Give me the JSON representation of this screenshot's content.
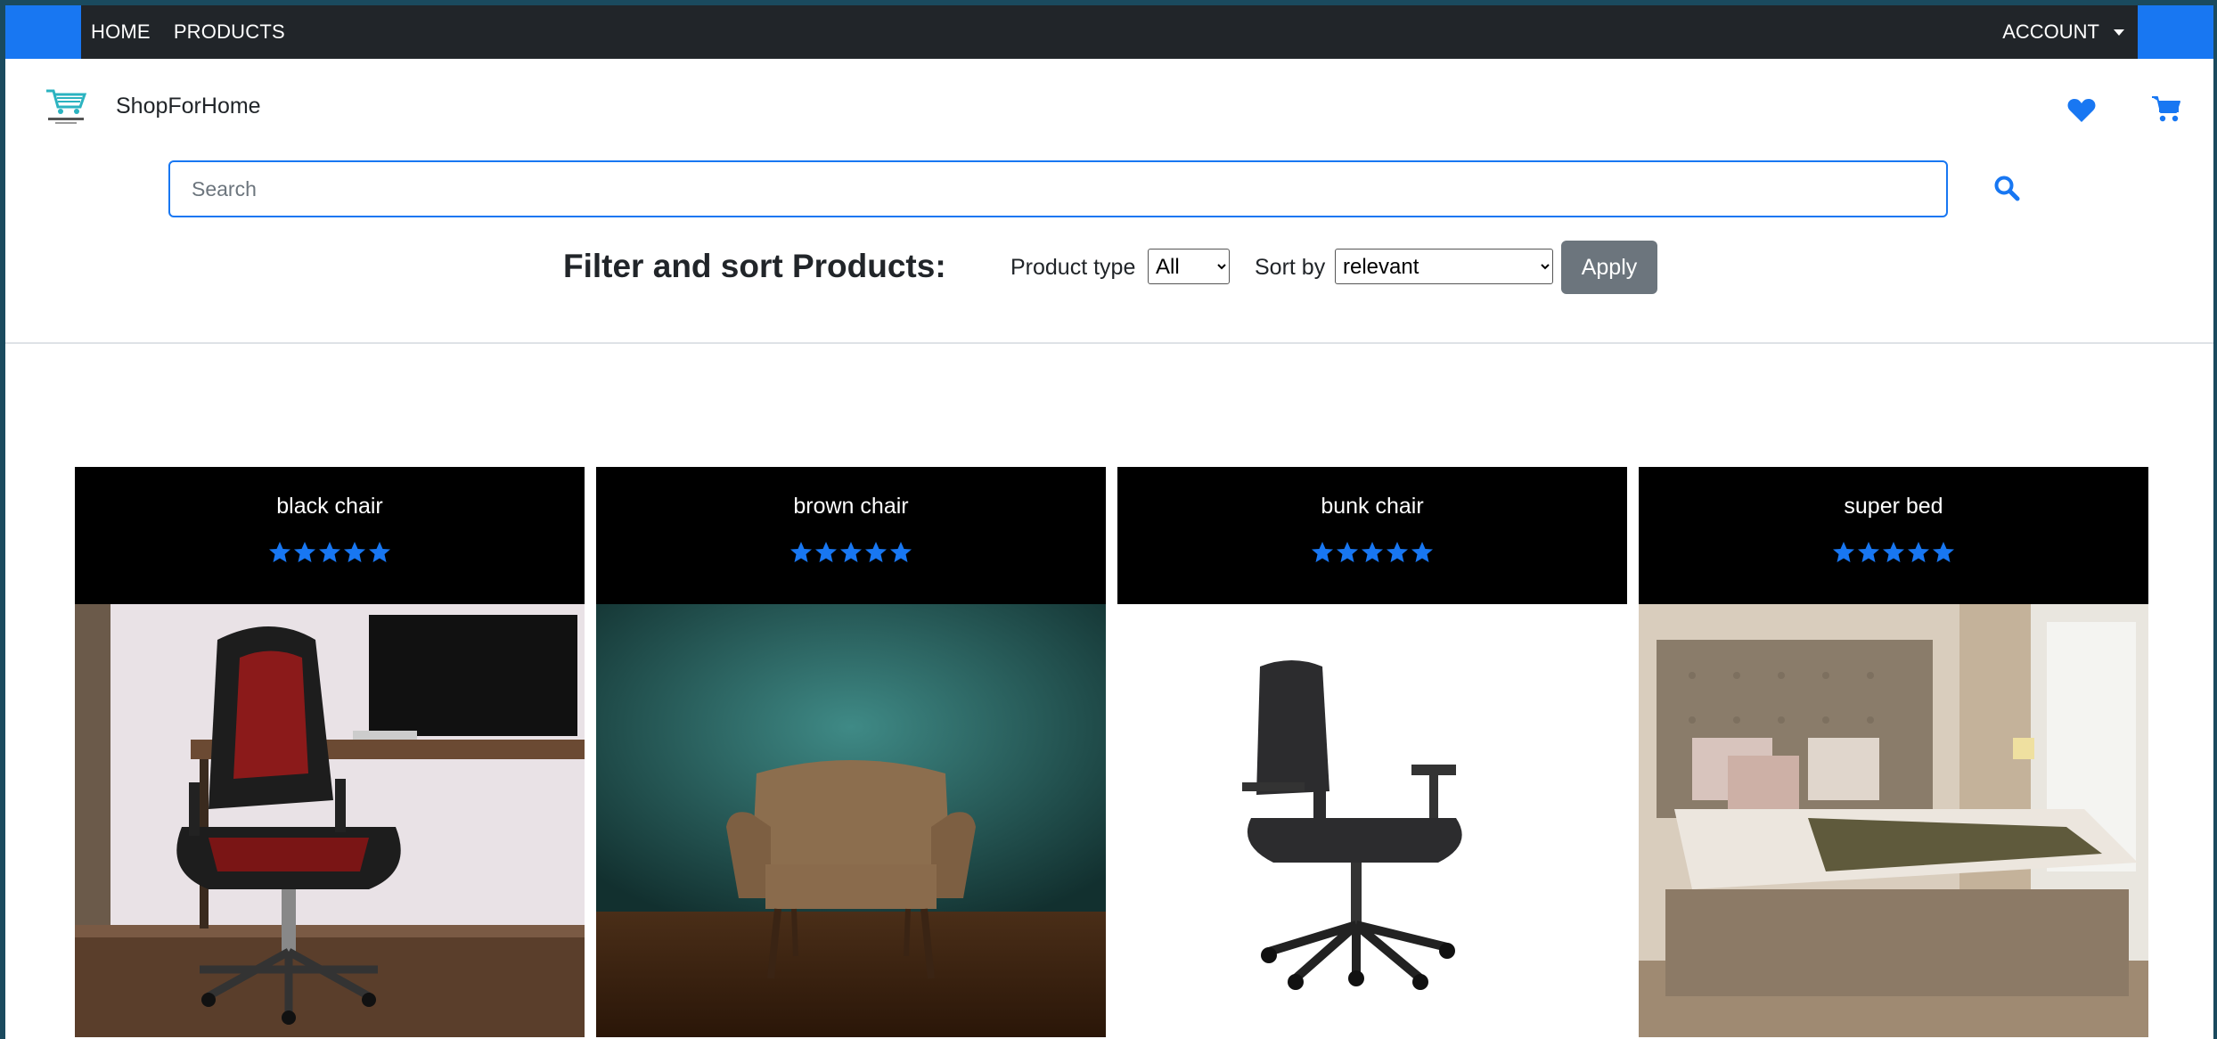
{
  "nav": {
    "home": "HOME",
    "products": "PRODUCTS",
    "account": "ACCOUNT"
  },
  "brand": {
    "name": "ShopForHome",
    "logo_icon": "shopping-cart-logo-icon"
  },
  "icons": {
    "wishlist": "heart-icon",
    "cart": "cart-icon",
    "search": "search-icon"
  },
  "search": {
    "placeholder": "Search",
    "value": ""
  },
  "filter": {
    "title": "Filter and sort Products:",
    "product_type_label": "Product type",
    "product_type_value": "All",
    "sort_label": "Sort by",
    "sort_value": "relevant",
    "apply_label": "Apply"
  },
  "colors": {
    "accent": "#1877f2",
    "navbar": "#212529",
    "apply_button": "#6c757d"
  },
  "products": [
    {
      "name": "black chair",
      "rating": 5,
      "max_rating": 5,
      "image": "black-red-gaming-chair"
    },
    {
      "name": "brown chair",
      "rating": 5,
      "max_rating": 5,
      "image": "brown-armchair"
    },
    {
      "name": "bunk chair",
      "rating": 5,
      "max_rating": 5,
      "image": "black-office-chair"
    },
    {
      "name": "super bed",
      "rating": 5,
      "max_rating": 5,
      "image": "upholstered-bed"
    }
  ]
}
